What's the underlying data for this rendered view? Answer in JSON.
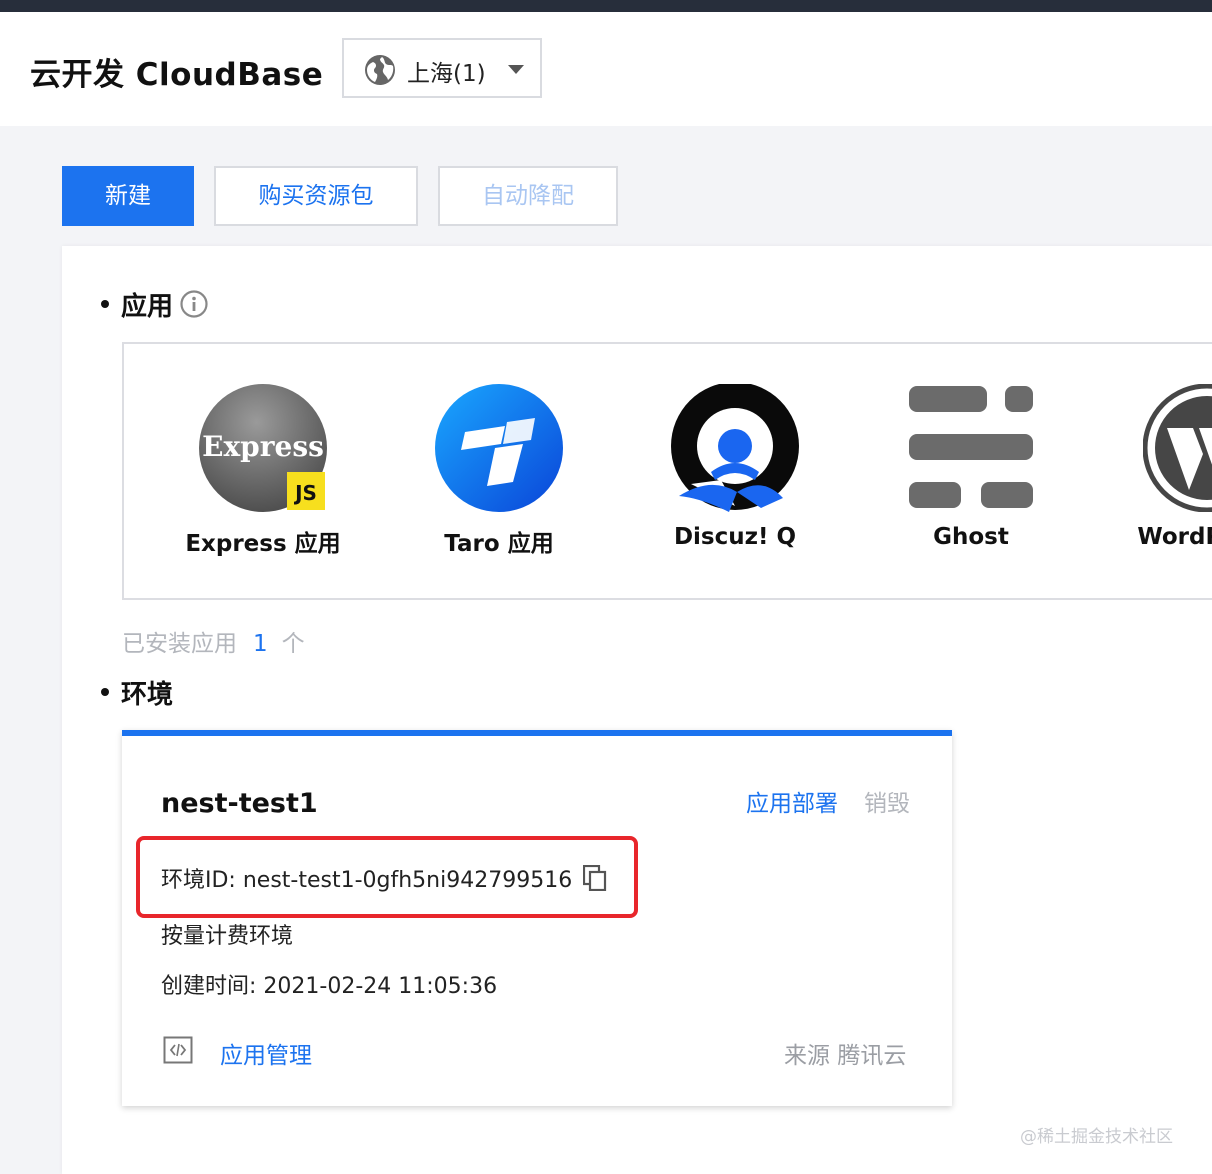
{
  "header": {
    "app_title": "云开发 CloudBase",
    "region_selector": {
      "icon": "globe-icon",
      "selected": "上海(1)"
    }
  },
  "toolbar": {
    "new_label": "新建",
    "buy_label": "购买资源包",
    "auto_label": "自动降配"
  },
  "apps_section": {
    "title": "应用",
    "info_icon": "info-circle-icon",
    "apps": [
      {
        "name": "Express 应用",
        "logo": "express-logo",
        "badge": "JS",
        "logo_text": "Express"
      },
      {
        "name": "Taro 应用",
        "logo": "taro-logo"
      },
      {
        "name": "Discuz! Q",
        "logo": "discuz-logo"
      },
      {
        "name": "Ghost",
        "logo": "ghost-logo"
      },
      {
        "name": "WordPress",
        "logo": "wordpress-logo"
      }
    ],
    "installed_label": "已安装应用",
    "installed_count": "1",
    "installed_unit": "个"
  },
  "env_section": {
    "title": "环境",
    "env": {
      "name": "nest-test1",
      "deploy_label": "应用部署",
      "destroy_label": "销毁",
      "id_label": "环境ID:",
      "id_value": "nest-test1-0gfh5ni942799516",
      "billing": "按量计费环境",
      "created_label": "创建时间:",
      "created_value": "2021-02-24 11:05:36",
      "manage_label": "应用管理",
      "source_label": "来源",
      "source_value": "腾讯云"
    }
  },
  "watermark": "@稀土掘金技术社区",
  "colors": {
    "primary": "#1c73ef",
    "highlight_border": "#e8262b",
    "top_strip": "#272e3b",
    "muted_text": "#b3b6bc"
  }
}
